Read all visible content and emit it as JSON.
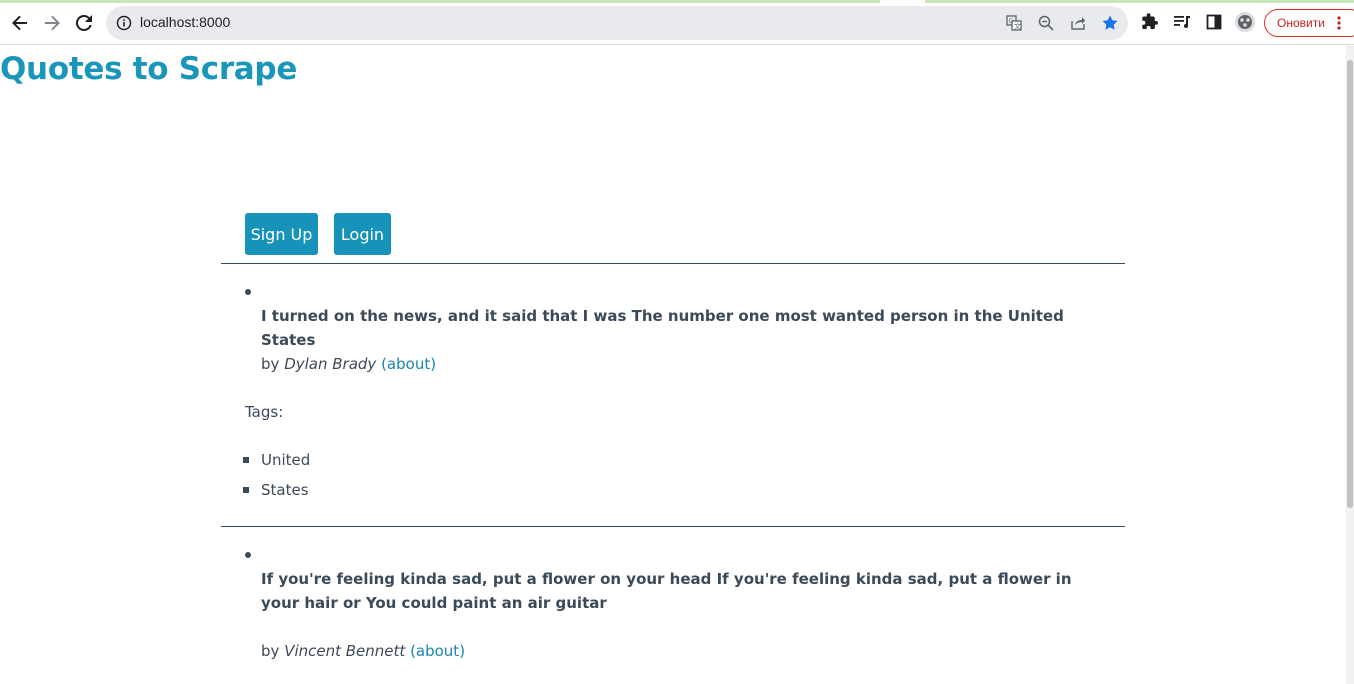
{
  "browser": {
    "url": "localhost:8000",
    "update_label": "Оновити"
  },
  "site": {
    "title": "Quotes to Scrape"
  },
  "auth": {
    "signup_label": "Sign Up",
    "login_label": "Login"
  },
  "quotes": [
    {
      "text": "I turned on the news, and it said that I was The number one most wanted person in the United States",
      "by": "by",
      "author": "Dylan Brady",
      "about": "(about)",
      "tags_label": "Tags:",
      "tags": [
        "United",
        "States"
      ]
    },
    {
      "text": "If you're feeling kinda sad, put a flower on your head If you're feeling kinda sad, put a flower in your hair or You could paint an air guitar",
      "by": "by",
      "author": "Vincent Bennett",
      "about": "(about)"
    }
  ],
  "colors": {
    "accent": "#1792b8",
    "title": "#1a96bb",
    "text": "#3b4a59",
    "link": "#1a86b0",
    "bookmark_star": "#1a73e8"
  },
  "icons": [
    "back-icon",
    "forward-icon",
    "reload-icon",
    "info-icon",
    "translate-icon",
    "zoom-icon",
    "share-icon",
    "star-icon",
    "extensions-icon",
    "media-icon",
    "side-panel-icon",
    "profile-icon",
    "more-icon"
  ]
}
